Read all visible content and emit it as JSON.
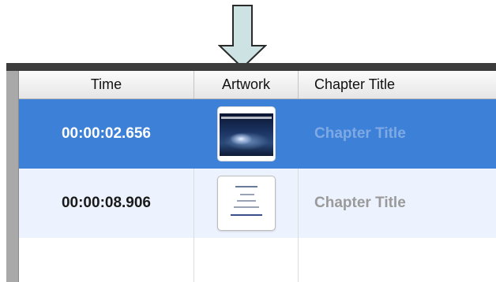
{
  "columns": {
    "time": "Time",
    "artwork": "Artwork",
    "chapter_title": "Chapter Title"
  },
  "rows": [
    {
      "time": "00:00:02.656",
      "artwork": "space-artwork",
      "chapter_title": "Chapter Title",
      "selected": true
    },
    {
      "time": "00:00:08.906",
      "artwork": "document-artwork",
      "chapter_title": "Chapter Title",
      "selected": false
    }
  ],
  "colors": {
    "selected_row": "#3d80d8",
    "alt_row": "#edf3fe",
    "arrow_fill": "#cde3e3",
    "arrow_stroke": "#2a2a2a"
  },
  "icons": {
    "annotation": "down-arrow-icon"
  }
}
